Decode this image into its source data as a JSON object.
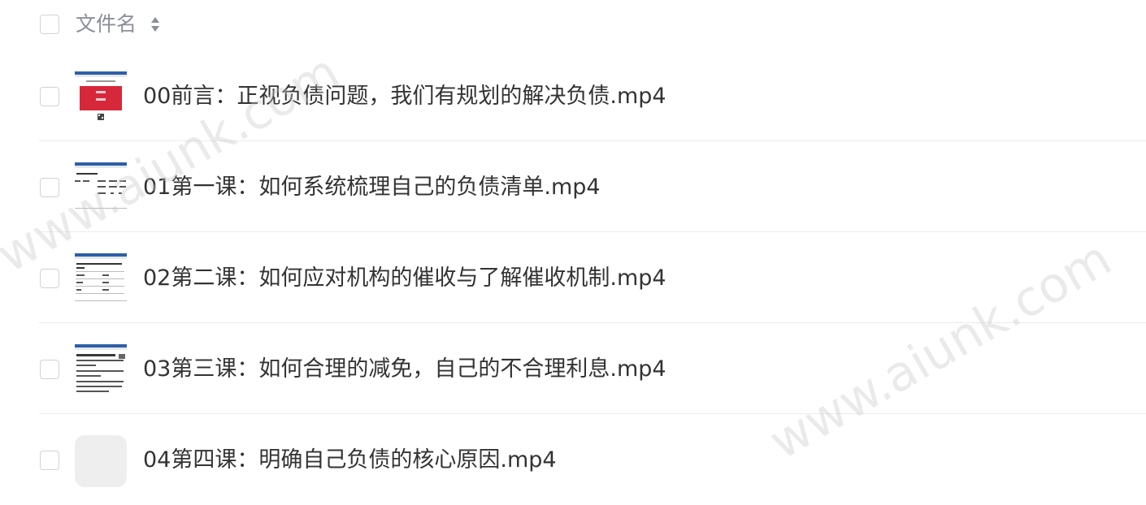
{
  "header": {
    "title": "文件名"
  },
  "files": [
    {
      "name": "00前言：正视负债问题，我们有规划的解决负债.mp4",
      "thumb": "doc-red"
    },
    {
      "name": "01第一课：如何系统梳理自己的负债清单.mp4",
      "thumb": "doc-table"
    },
    {
      "name": "02第二课：如何应对机构的催收与了解催收机制.mp4",
      "thumb": "doc-table2"
    },
    {
      "name": "03第三课：如何合理的减免，自己的不合理利息.mp4",
      "thumb": "doc-text"
    },
    {
      "name": "04第四课：明确自己负债的核心原因.mp4",
      "thumb": "empty"
    }
  ],
  "watermark": {
    "text": "www.aiunk.com"
  },
  "colors": {
    "header_text": "#8a8f99",
    "file_text": "#333333",
    "thumb_red": "#d6283a",
    "doc_header": "#2d5fa8"
  }
}
